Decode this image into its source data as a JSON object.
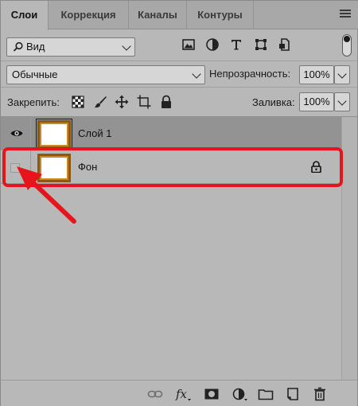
{
  "tabs": [
    {
      "label": "Слои",
      "active": true
    },
    {
      "label": "Коррекция",
      "active": false
    },
    {
      "label": "Каналы",
      "active": false
    },
    {
      "label": "Контуры",
      "active": false
    }
  ],
  "filter": {
    "kind_label": "Вид",
    "icons": [
      "image-filter-icon",
      "adjustment-filter-icon",
      "type-filter-icon",
      "shape-filter-icon",
      "smart-object-filter-icon"
    ]
  },
  "blend": {
    "mode": "Обычные",
    "opacity_label": "Непрозрачность:",
    "opacity_value": "100%"
  },
  "lock": {
    "label": "Закрепить:",
    "icons": [
      "lock-transparent-pixels-icon",
      "lock-image-pixels-icon",
      "lock-position-icon",
      "lock-artboard-icon",
      "lock-all-icon"
    ],
    "fill_label": "Заливка:",
    "fill_value": "100%"
  },
  "layers": [
    {
      "name": "Слой 1",
      "visible": true,
      "selected": true,
      "locked": false
    },
    {
      "name": "Фон",
      "visible": false,
      "selected": false,
      "locked": true
    }
  ],
  "footer_icons": [
    "link-layers-icon",
    "fx-icon",
    "add-mask-icon",
    "new-adjustment-layer-icon",
    "new-group-icon",
    "new-layer-icon",
    "delete-layer-icon"
  ],
  "colors": {
    "highlight": "#e8141c",
    "panel_bg": "#b8b8b8",
    "selected_row": "#939393"
  }
}
